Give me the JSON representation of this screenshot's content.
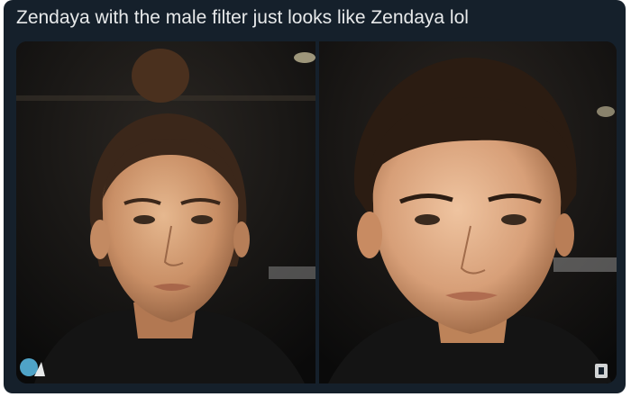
{
  "tweet": {
    "text": "Zendaya with the male filter just looks like Zendaya lol"
  },
  "media": {
    "panels": [
      {
        "kind": "photo",
        "subject": "original-photo"
      },
      {
        "kind": "photo",
        "subject": "male-filter-photo"
      }
    ],
    "icons": [
      "media-badge-icon",
      "alt-text-icon"
    ]
  },
  "colors": {
    "background": "#15202b",
    "text": "#e7e9ea",
    "photo_background": "#0c0c0c"
  }
}
